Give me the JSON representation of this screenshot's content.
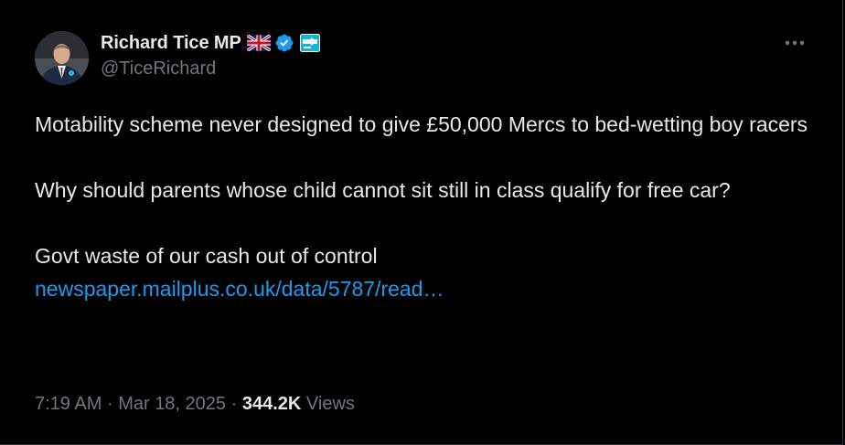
{
  "author": {
    "display_name": "Richard Tice MP",
    "handle": "@TiceRichard",
    "flag": "uk-flag-icon",
    "badge": "verified-icon",
    "affiliate": "party-logo-icon",
    "badge_color": "#1d9bf0"
  },
  "tweet": {
    "paragraph1": "Motability scheme never designed to give £50,000 Mercs to bed-wetting boy racers",
    "paragraph2": "Why should parents whose child cannot sit still in class qualify for free car?",
    "paragraph3": "Govt waste of our cash out of control",
    "link_text": "newspaper.mailplus.co.uk/data/5787/read…",
    "link_color": "#1d9bf0"
  },
  "meta": {
    "time": "7:19 AM",
    "separator1": "·",
    "date": "Mar 18, 2025",
    "separator2": "·",
    "views_count": "344.2K",
    "views_label": "Views"
  },
  "actions": {
    "more_icon": "more-horizontal-icon"
  }
}
